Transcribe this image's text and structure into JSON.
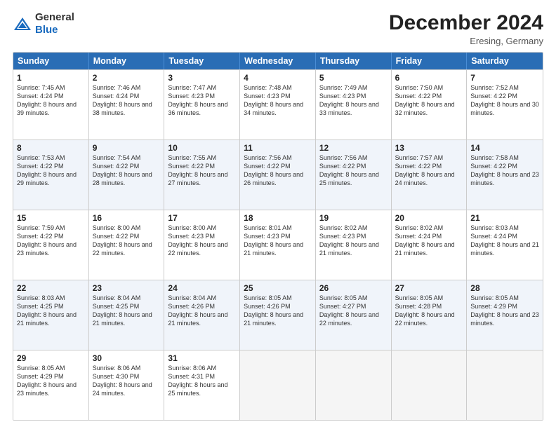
{
  "logo": {
    "general": "General",
    "blue": "Blue"
  },
  "title": "December 2024",
  "location": "Eresing, Germany",
  "days": [
    "Sunday",
    "Monday",
    "Tuesday",
    "Wednesday",
    "Thursday",
    "Friday",
    "Saturday"
  ],
  "weeks": [
    [
      {
        "day": "1",
        "sunrise": "7:45 AM",
        "sunset": "4:24 PM",
        "daylight": "8 hours and 39 minutes."
      },
      {
        "day": "2",
        "sunrise": "7:46 AM",
        "sunset": "4:24 PM",
        "daylight": "8 hours and 38 minutes."
      },
      {
        "day": "3",
        "sunrise": "7:47 AM",
        "sunset": "4:23 PM",
        "daylight": "8 hours and 36 minutes."
      },
      {
        "day": "4",
        "sunrise": "7:48 AM",
        "sunset": "4:23 PM",
        "daylight": "8 hours and 34 minutes."
      },
      {
        "day": "5",
        "sunrise": "7:49 AM",
        "sunset": "4:23 PM",
        "daylight": "8 hours and 33 minutes."
      },
      {
        "day": "6",
        "sunrise": "7:50 AM",
        "sunset": "4:22 PM",
        "daylight": "8 hours and 32 minutes."
      },
      {
        "day": "7",
        "sunrise": "7:52 AM",
        "sunset": "4:22 PM",
        "daylight": "8 hours and 30 minutes."
      }
    ],
    [
      {
        "day": "8",
        "sunrise": "7:53 AM",
        "sunset": "4:22 PM",
        "daylight": "8 hours and 29 minutes."
      },
      {
        "day": "9",
        "sunrise": "7:54 AM",
        "sunset": "4:22 PM",
        "daylight": "8 hours and 28 minutes."
      },
      {
        "day": "10",
        "sunrise": "7:55 AM",
        "sunset": "4:22 PM",
        "daylight": "8 hours and 27 minutes."
      },
      {
        "day": "11",
        "sunrise": "7:56 AM",
        "sunset": "4:22 PM",
        "daylight": "8 hours and 26 minutes."
      },
      {
        "day": "12",
        "sunrise": "7:56 AM",
        "sunset": "4:22 PM",
        "daylight": "8 hours and 25 minutes."
      },
      {
        "day": "13",
        "sunrise": "7:57 AM",
        "sunset": "4:22 PM",
        "daylight": "8 hours and 24 minutes."
      },
      {
        "day": "14",
        "sunrise": "7:58 AM",
        "sunset": "4:22 PM",
        "daylight": "8 hours and 23 minutes."
      }
    ],
    [
      {
        "day": "15",
        "sunrise": "7:59 AM",
        "sunset": "4:22 PM",
        "daylight": "8 hours and 23 minutes."
      },
      {
        "day": "16",
        "sunrise": "8:00 AM",
        "sunset": "4:22 PM",
        "daylight": "8 hours and 22 minutes."
      },
      {
        "day": "17",
        "sunrise": "8:00 AM",
        "sunset": "4:23 PM",
        "daylight": "8 hours and 22 minutes."
      },
      {
        "day": "18",
        "sunrise": "8:01 AM",
        "sunset": "4:23 PM",
        "daylight": "8 hours and 21 minutes."
      },
      {
        "day": "19",
        "sunrise": "8:02 AM",
        "sunset": "4:23 PM",
        "daylight": "8 hours and 21 minutes."
      },
      {
        "day": "20",
        "sunrise": "8:02 AM",
        "sunset": "4:24 PM",
        "daylight": "8 hours and 21 minutes."
      },
      {
        "day": "21",
        "sunrise": "8:03 AM",
        "sunset": "4:24 PM",
        "daylight": "8 hours and 21 minutes."
      }
    ],
    [
      {
        "day": "22",
        "sunrise": "8:03 AM",
        "sunset": "4:25 PM",
        "daylight": "8 hours and 21 minutes."
      },
      {
        "day": "23",
        "sunrise": "8:04 AM",
        "sunset": "4:25 PM",
        "daylight": "8 hours and 21 minutes."
      },
      {
        "day": "24",
        "sunrise": "8:04 AM",
        "sunset": "4:26 PM",
        "daylight": "8 hours and 21 minutes."
      },
      {
        "day": "25",
        "sunrise": "8:05 AM",
        "sunset": "4:26 PM",
        "daylight": "8 hours and 21 minutes."
      },
      {
        "day": "26",
        "sunrise": "8:05 AM",
        "sunset": "4:27 PM",
        "daylight": "8 hours and 22 minutes."
      },
      {
        "day": "27",
        "sunrise": "8:05 AM",
        "sunset": "4:28 PM",
        "daylight": "8 hours and 22 minutes."
      },
      {
        "day": "28",
        "sunrise": "8:05 AM",
        "sunset": "4:29 PM",
        "daylight": "8 hours and 23 minutes."
      }
    ],
    [
      {
        "day": "29",
        "sunrise": "8:05 AM",
        "sunset": "4:29 PM",
        "daylight": "8 hours and 23 minutes."
      },
      {
        "day": "30",
        "sunrise": "8:06 AM",
        "sunset": "4:30 PM",
        "daylight": "8 hours and 24 minutes."
      },
      {
        "day": "31",
        "sunrise": "8:06 AM",
        "sunset": "4:31 PM",
        "daylight": "8 hours and 25 minutes."
      },
      null,
      null,
      null,
      null
    ]
  ],
  "labels": {
    "sunrise": "Sunrise:",
    "sunset": "Sunset:",
    "daylight": "Daylight:"
  }
}
